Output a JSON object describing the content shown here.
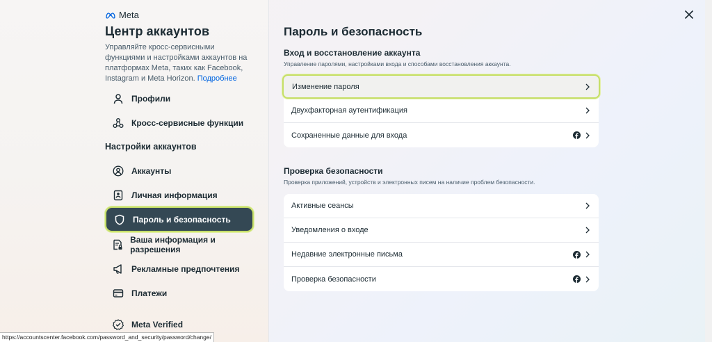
{
  "sidebar": {
    "logo_text": "Meta",
    "title": "Центр аккаунтов",
    "description": "Управляйте кросс-сервисными функциями и настройками аккаунтов на платформах Meta, таких как Facebook, Instagram и Meta Horizon.",
    "learn_more": "Подробнее",
    "top_items": [
      {
        "label": "Профили",
        "icon": "profile-icon"
      },
      {
        "label": "Кросс-сервисные функции",
        "icon": "connected-icon"
      }
    ],
    "section_heading": "Настройки аккаунтов",
    "settings_items": [
      {
        "label": "Аккаунты",
        "icon": "account-circle-icon"
      },
      {
        "label": "Личная информация",
        "icon": "id-card-icon"
      },
      {
        "label": "Пароль и безопасность",
        "icon": "shield-icon"
      },
      {
        "label": "Ваша информация и разрешения",
        "icon": "doc-lock-icon"
      },
      {
        "label": "Рекламные предпочтения",
        "icon": "megaphone-icon"
      },
      {
        "label": "Платежи",
        "icon": "card-icon"
      },
      {
        "label": "Meta Verified",
        "icon": "verified-badge-icon"
      }
    ]
  },
  "main": {
    "title": "Пароль и безопасность",
    "login_group": {
      "title": "Вход и восстановление аккаунта",
      "subtitle": "Управление паролями, настройками входа и способами восстановления аккаунта.",
      "rows": [
        {
          "label": "Изменение пароля",
          "fb": false
        },
        {
          "label": "Двухфакторная аутентификация",
          "fb": false
        },
        {
          "label": "Сохраненные данные для входа",
          "fb": true
        }
      ]
    },
    "security_group": {
      "title": "Проверка безопасности",
      "subtitle": "Проверка приложений, устройств и электронных писем на наличие проблем безопасности.",
      "rows": [
        {
          "label": "Активные сеансы",
          "fb": false
        },
        {
          "label": "Уведомления о входе",
          "fb": false
        },
        {
          "label": "Недавние электронные письма",
          "fb": true
        },
        {
          "label": "Проверка безопасности",
          "fb": true
        }
      ]
    }
  },
  "status_url": "https://accountscenter.facebook.com/password_and_security/password/change/",
  "colors": {
    "accent": "#0064e0",
    "active_bg": "#344854",
    "highlight": "#c8e06a"
  }
}
